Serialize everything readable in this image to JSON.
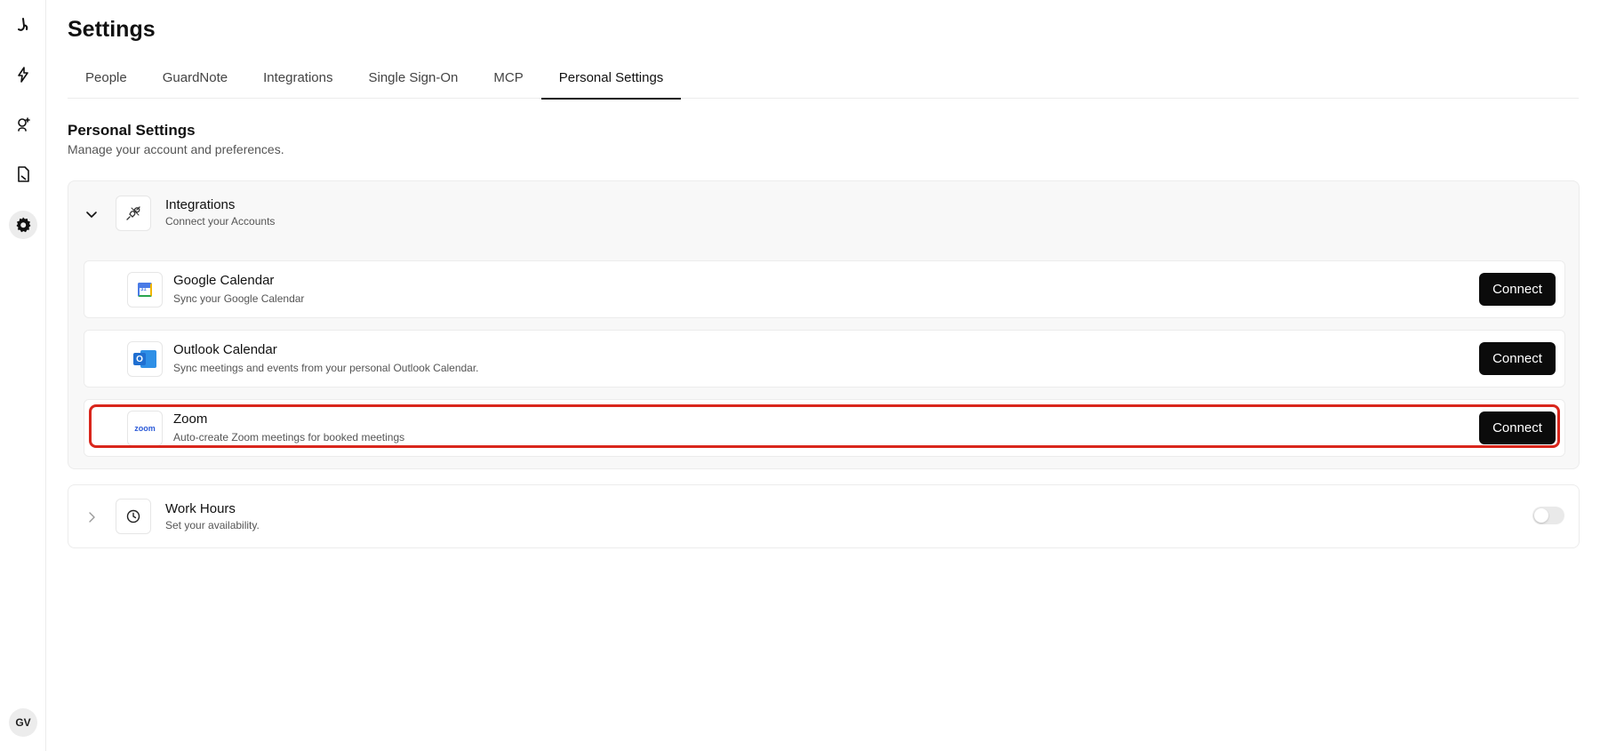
{
  "sidebar": {
    "items": [
      {
        "icon": "logo-icon"
      },
      {
        "icon": "lightning-icon"
      },
      {
        "icon": "user-add-icon"
      },
      {
        "icon": "document-icon"
      },
      {
        "icon": "gear-icon",
        "active": true
      }
    ],
    "avatar_initials": "GV"
  },
  "header": {
    "title": "Settings"
  },
  "tabs": [
    {
      "label": "People"
    },
    {
      "label": "GuardNote"
    },
    {
      "label": "Integrations"
    },
    {
      "label": "Single Sign-On"
    },
    {
      "label": "MCP"
    },
    {
      "label": "Personal Settings",
      "active": true
    }
  ],
  "section": {
    "title": "Personal Settings",
    "subtitle": "Manage your account and preferences."
  },
  "integrations_card": {
    "title": "Integrations",
    "subtitle": "Connect your Accounts",
    "expanded": true,
    "icon": "plug-icon",
    "items": [
      {
        "name": "Google Calendar",
        "description": "Sync your Google Calendar",
        "button": "Connect",
        "logo": "google-calendar-logo",
        "logo_text": "31"
      },
      {
        "name": "Outlook Calendar",
        "description": "Sync meetings and events from your personal Outlook Calendar.",
        "button": "Connect",
        "logo": "outlook-logo",
        "logo_text": "O"
      },
      {
        "name": "Zoom",
        "description": "Auto-create Zoom meetings for booked meetings",
        "button": "Connect",
        "logo": "zoom-logo",
        "logo_text": "zoom"
      }
    ]
  },
  "work_hours_card": {
    "title": "Work Hours",
    "subtitle": "Set your availability.",
    "icon": "clock-icon",
    "enabled": false
  },
  "colors": {
    "accent": "#0b0b0b",
    "highlight": "#d9261c",
    "zoom_blue": "#2d5bd8",
    "outlook_blue": "#1f6fd1",
    "google_blue": "#4a7be6"
  }
}
